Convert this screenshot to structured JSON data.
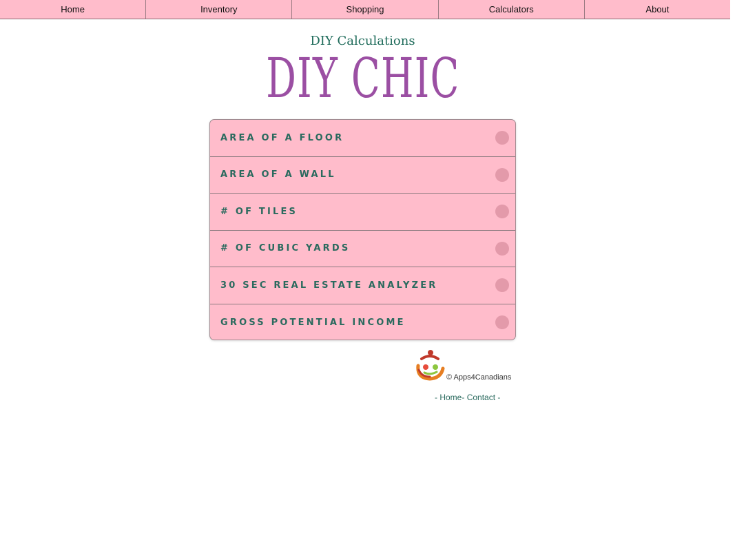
{
  "nav": {
    "items": [
      {
        "label": "Home"
      },
      {
        "label": "Inventory"
      },
      {
        "label": "Shopping"
      },
      {
        "label": "Calculators"
      },
      {
        "label": "About"
      }
    ]
  },
  "header": {
    "subtitle": "DIY Calculations",
    "logo_text": "DIY CHIC"
  },
  "menu": {
    "items": [
      {
        "label": "AREA OF A FLOOR",
        "icon": "arrow-circle-icon"
      },
      {
        "label": "AREA OF A WALL",
        "icon": "arrow-circle-icon"
      },
      {
        "label": "# OF TILES",
        "icon": "arrow-circle-icon"
      },
      {
        "label": "# OF CUBIC YARDS",
        "icon": "arrow-circle-icon"
      },
      {
        "label": "30 SEC REAL ESTATE ANALYZER",
        "icon": "arrow-circle-icon"
      },
      {
        "label": "GROSS POTENTIAL INCOME",
        "icon": "arrow-circle-icon"
      }
    ]
  },
  "footer": {
    "copyright": "© Apps4Canadians",
    "links_prefix": "- ",
    "home_link": "Home",
    "separator": "- ",
    "contact_link": "Contact",
    "links_suffix": " -"
  },
  "colors": {
    "nav_bg": "#ffbccb",
    "menu_bg": "#ffbccb",
    "logo": "#9b4fa3",
    "teal_text": "#2a6a5e"
  }
}
